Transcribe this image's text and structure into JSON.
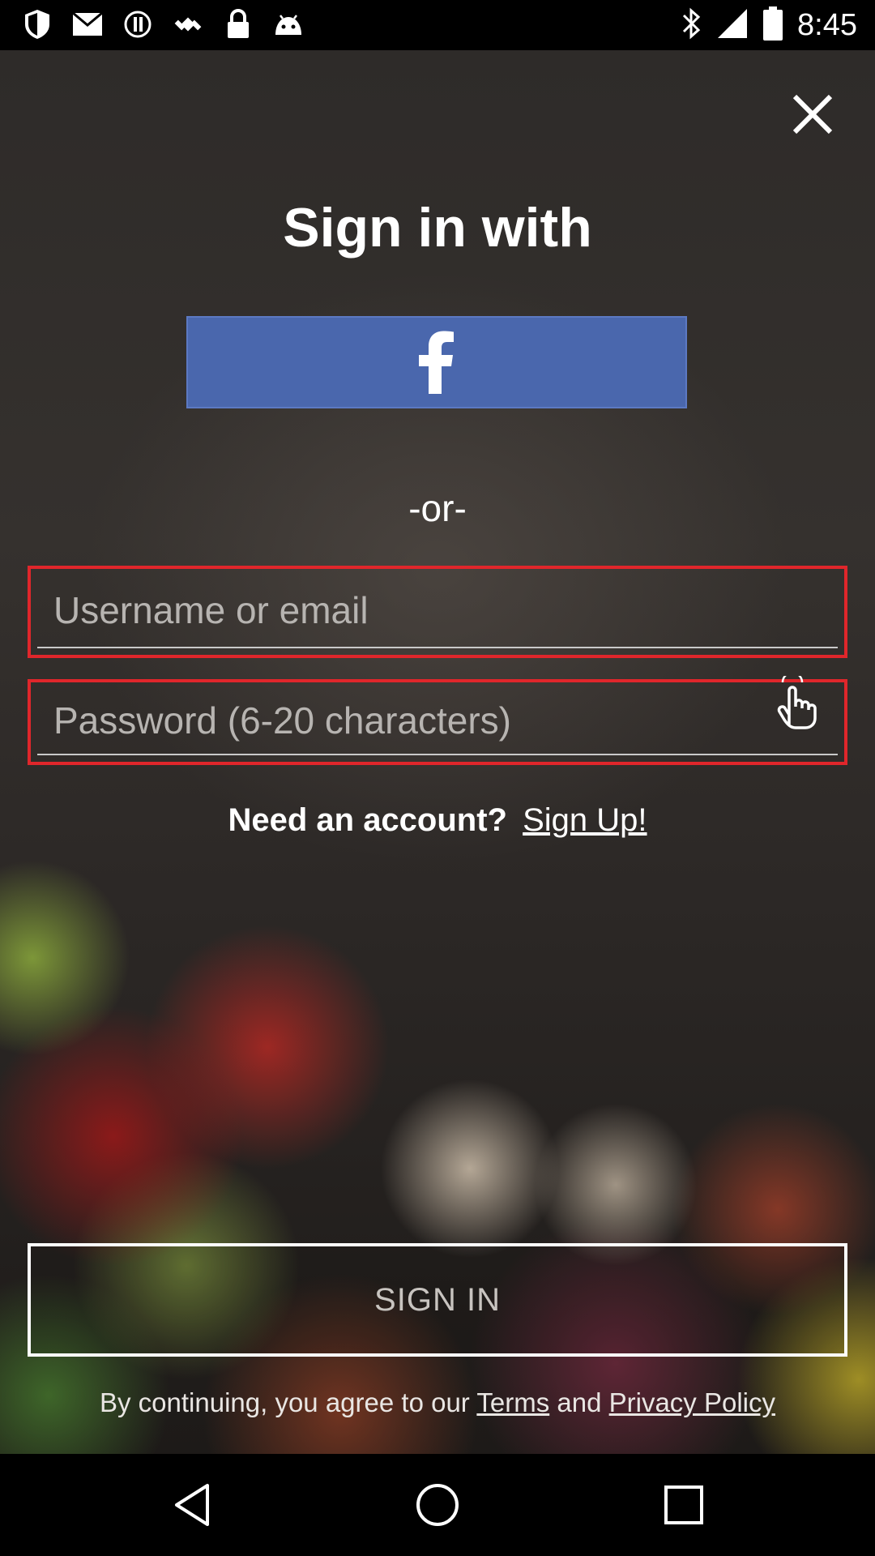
{
  "status_bar": {
    "time": "8:45",
    "left_icons": [
      "shield-icon",
      "mail-icon",
      "alert-icon",
      "fake-gps-icon",
      "lock-icon",
      "android-icon"
    ],
    "right_icons": [
      "bluetooth-icon",
      "signal-icon",
      "battery-icon"
    ]
  },
  "signin": {
    "title": "Sign in with",
    "facebook_icon": "facebook-icon",
    "or_text": "-or-",
    "username_placeholder": "Username or email",
    "password_placeholder": "Password (6-20 characters)",
    "need_account_text": "Need an account?",
    "signup_link": "Sign Up!",
    "signin_button": "SIGN IN",
    "legal_prefix": "By continuing, you agree to our",
    "terms_link": "Terms",
    "legal_and": "and",
    "privacy_link": "Privacy Policy"
  },
  "colors": {
    "facebook_blue": "#4a67ad",
    "field_border_red": "#e0262b"
  },
  "nav_bar": {
    "icons": [
      "back-icon",
      "home-icon",
      "recents-icon"
    ]
  }
}
